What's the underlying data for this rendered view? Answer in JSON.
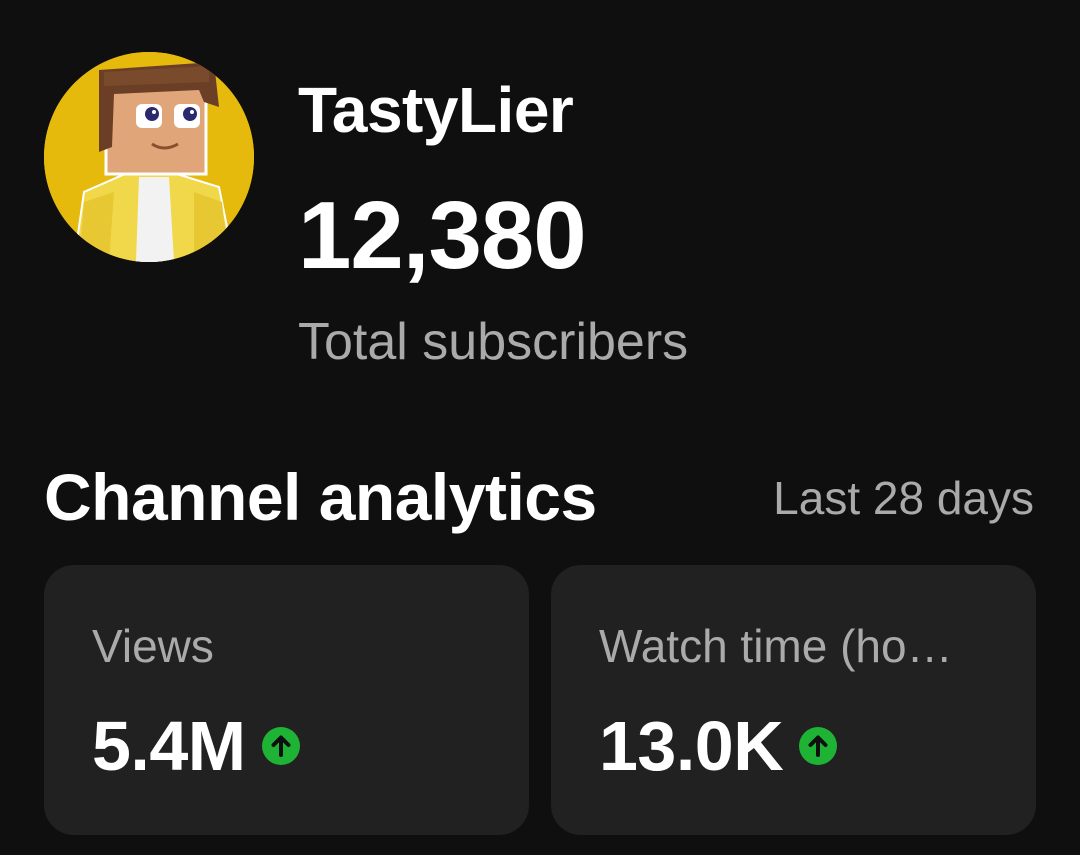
{
  "channel": {
    "name": "TastyLier",
    "subscriber_count": "12,380",
    "subscriber_label": "Total subscribers",
    "avatar_icon": "minecraft-character-avatar"
  },
  "analytics": {
    "title": "Channel analytics",
    "period": "Last 28 days",
    "cards": [
      {
        "label": "Views",
        "value": "5.4M",
        "trend": "up",
        "trend_icon": "arrow-up-circle-icon"
      },
      {
        "label": "Watch time (ho…",
        "value": "13.0K",
        "trend": "up",
        "trend_icon": "arrow-up-circle-icon"
      }
    ]
  },
  "colors": {
    "background": "#0f0f0f",
    "card_background": "#212121",
    "secondary_text": "#aaaaaa",
    "trend_up": "#1fb336",
    "avatar_background": "#d9ad06"
  }
}
